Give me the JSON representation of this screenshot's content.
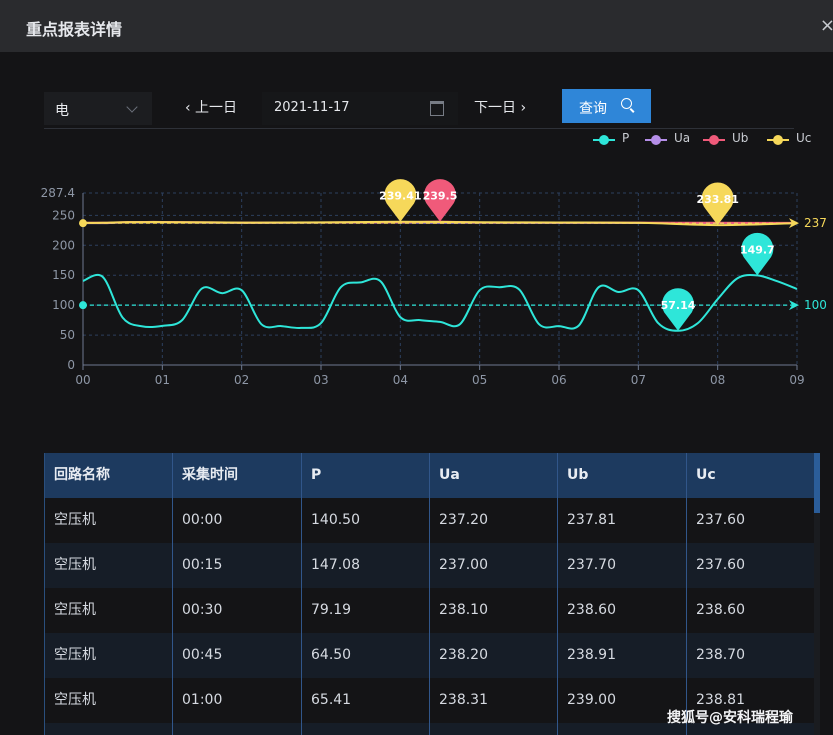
{
  "window": {
    "title": "重点报表详情",
    "close_icon": "close-icon"
  },
  "toolbar": {
    "category_select": {
      "value": "电"
    },
    "prev_label": "‹ 上一日",
    "date_value": "2021-11-17",
    "next_label": "下一日 ›",
    "query_label": "查询"
  },
  "legend": [
    {
      "name": "P",
      "color": "#2ee6d9"
    },
    {
      "name": "Ua",
      "color": "#b58ee8"
    },
    {
      "name": "Ub",
      "color": "#f05a7a"
    },
    {
      "name": "Uc",
      "color": "#f6d85a"
    }
  ],
  "chart_data": {
    "type": "line",
    "x": [
      "00",
      "01",
      "02",
      "03",
      "04",
      "05",
      "06",
      "07",
      "08",
      "09"
    ],
    "y_ticks": [
      "287.4",
      "250",
      "200",
      "150",
      "100",
      "50",
      "0"
    ],
    "ylim": [
      0,
      287.4
    ],
    "grid": true,
    "legend_position": "top-right",
    "series": [
      {
        "name": "P",
        "color": "#2ee6d9",
        "points": [
          [
            0,
            140.5
          ],
          [
            0.25,
            147.08
          ],
          [
            0.5,
            79.19
          ],
          [
            0.75,
            64.5
          ],
          [
            1,
            65.41
          ],
          [
            1.25,
            75
          ],
          [
            1.5,
            128
          ],
          [
            1.75,
            120
          ],
          [
            2,
            125
          ],
          [
            2.25,
            68
          ],
          [
            2.5,
            65
          ],
          [
            2.75,
            62
          ],
          [
            3,
            70
          ],
          [
            3.25,
            130
          ],
          [
            3.5,
            138
          ],
          [
            3.75,
            140
          ],
          [
            4,
            80
          ],
          [
            4.25,
            75
          ],
          [
            4.5,
            72
          ],
          [
            4.75,
            68
          ],
          [
            5,
            125
          ],
          [
            5.25,
            130
          ],
          [
            5.5,
            126
          ],
          [
            5.75,
            68
          ],
          [
            6,
            65
          ],
          [
            6.25,
            66
          ],
          [
            6.5,
            130
          ],
          [
            6.75,
            122
          ],
          [
            7,
            125
          ],
          [
            7.25,
            70
          ],
          [
            7.5,
            57.14
          ],
          [
            7.75,
            70
          ],
          [
            8,
            110
          ],
          [
            8.25,
            145
          ],
          [
            8.5,
            149.7
          ],
          [
            8.75,
            140
          ],
          [
            9,
            127
          ]
        ],
        "markpoints": [
          {
            "label": "57.14",
            "x": 7.5,
            "y": 57.14
          },
          {
            "label": "149.7",
            "x": 8.5,
            "y": 149.7
          }
        ],
        "markline": {
          "label": "100",
          "y": 100
        }
      },
      {
        "name": "Ua",
        "color": "#b58ee8",
        "points": [
          [
            0,
            237.2
          ],
          [
            0.25,
            237.0
          ],
          [
            0.5,
            238.1
          ],
          [
            0.75,
            238.2
          ],
          [
            1,
            238.31
          ],
          [
            2,
            237.5
          ],
          [
            3,
            237.8
          ],
          [
            4,
            238
          ],
          [
            5,
            237.6
          ],
          [
            6,
            237.5
          ],
          [
            7,
            237.3
          ],
          [
            8,
            237.2
          ],
          [
            9,
            237
          ]
        ]
      },
      {
        "name": "Ub",
        "color": "#f05a7a",
        "points": [
          [
            0,
            237.81
          ],
          [
            0.25,
            237.7
          ],
          [
            0.5,
            238.6
          ],
          [
            0.75,
            238.91
          ],
          [
            1,
            239.0
          ],
          [
            2,
            238
          ],
          [
            3,
            238.2
          ],
          [
            4,
            238.6
          ],
          [
            4.5,
            239.5
          ],
          [
            5,
            238.2
          ],
          [
            6,
            238
          ],
          [
            7,
            237.8
          ],
          [
            8,
            237.6
          ],
          [
            9,
            237.4
          ]
        ],
        "markpoints": [
          {
            "label": "239.5",
            "x": 4.5,
            "y": 239.5
          }
        ]
      },
      {
        "name": "Uc",
        "color": "#f6d85a",
        "points": [
          [
            0,
            237.6
          ],
          [
            0.25,
            237.6
          ],
          [
            0.5,
            238.6
          ],
          [
            0.75,
            238.7
          ],
          [
            1,
            238.81
          ],
          [
            2,
            238
          ],
          [
            3,
            238.3
          ],
          [
            4,
            239.41
          ],
          [
            5,
            238.5
          ],
          [
            6,
            238.2
          ],
          [
            7,
            237.6
          ],
          [
            8,
            233.81
          ],
          [
            9,
            237
          ]
        ],
        "markpoints": [
          {
            "label": "239.41",
            "x": 4,
            "y": 239.41
          },
          {
            "label": "233.81",
            "x": 8,
            "y": 233.81
          }
        ],
        "markline": {
          "label": "237",
          "y": 237
        }
      }
    ]
  },
  "table": {
    "columns": [
      "回路名称",
      "采集时间",
      "P",
      "Ua",
      "Ub",
      "Uc"
    ],
    "rows": [
      [
        "空压机",
        "00:00",
        "140.50",
        "237.20",
        "237.81",
        "237.60"
      ],
      [
        "空压机",
        "00:15",
        "147.08",
        "237.00",
        "237.70",
        "237.60"
      ],
      [
        "空压机",
        "00:30",
        "79.19",
        "238.10",
        "238.60",
        "238.60"
      ],
      [
        "空压机",
        "00:45",
        "64.50",
        "238.20",
        "238.91",
        "238.70"
      ],
      [
        "空压机",
        "01:00",
        "65.41",
        "238.31",
        "239.00",
        "238.81"
      ],
      [
        "",
        "",
        "",
        "",
        "",
        ""
      ]
    ]
  },
  "watermark": "搜狐号@安科瑞程瑜"
}
